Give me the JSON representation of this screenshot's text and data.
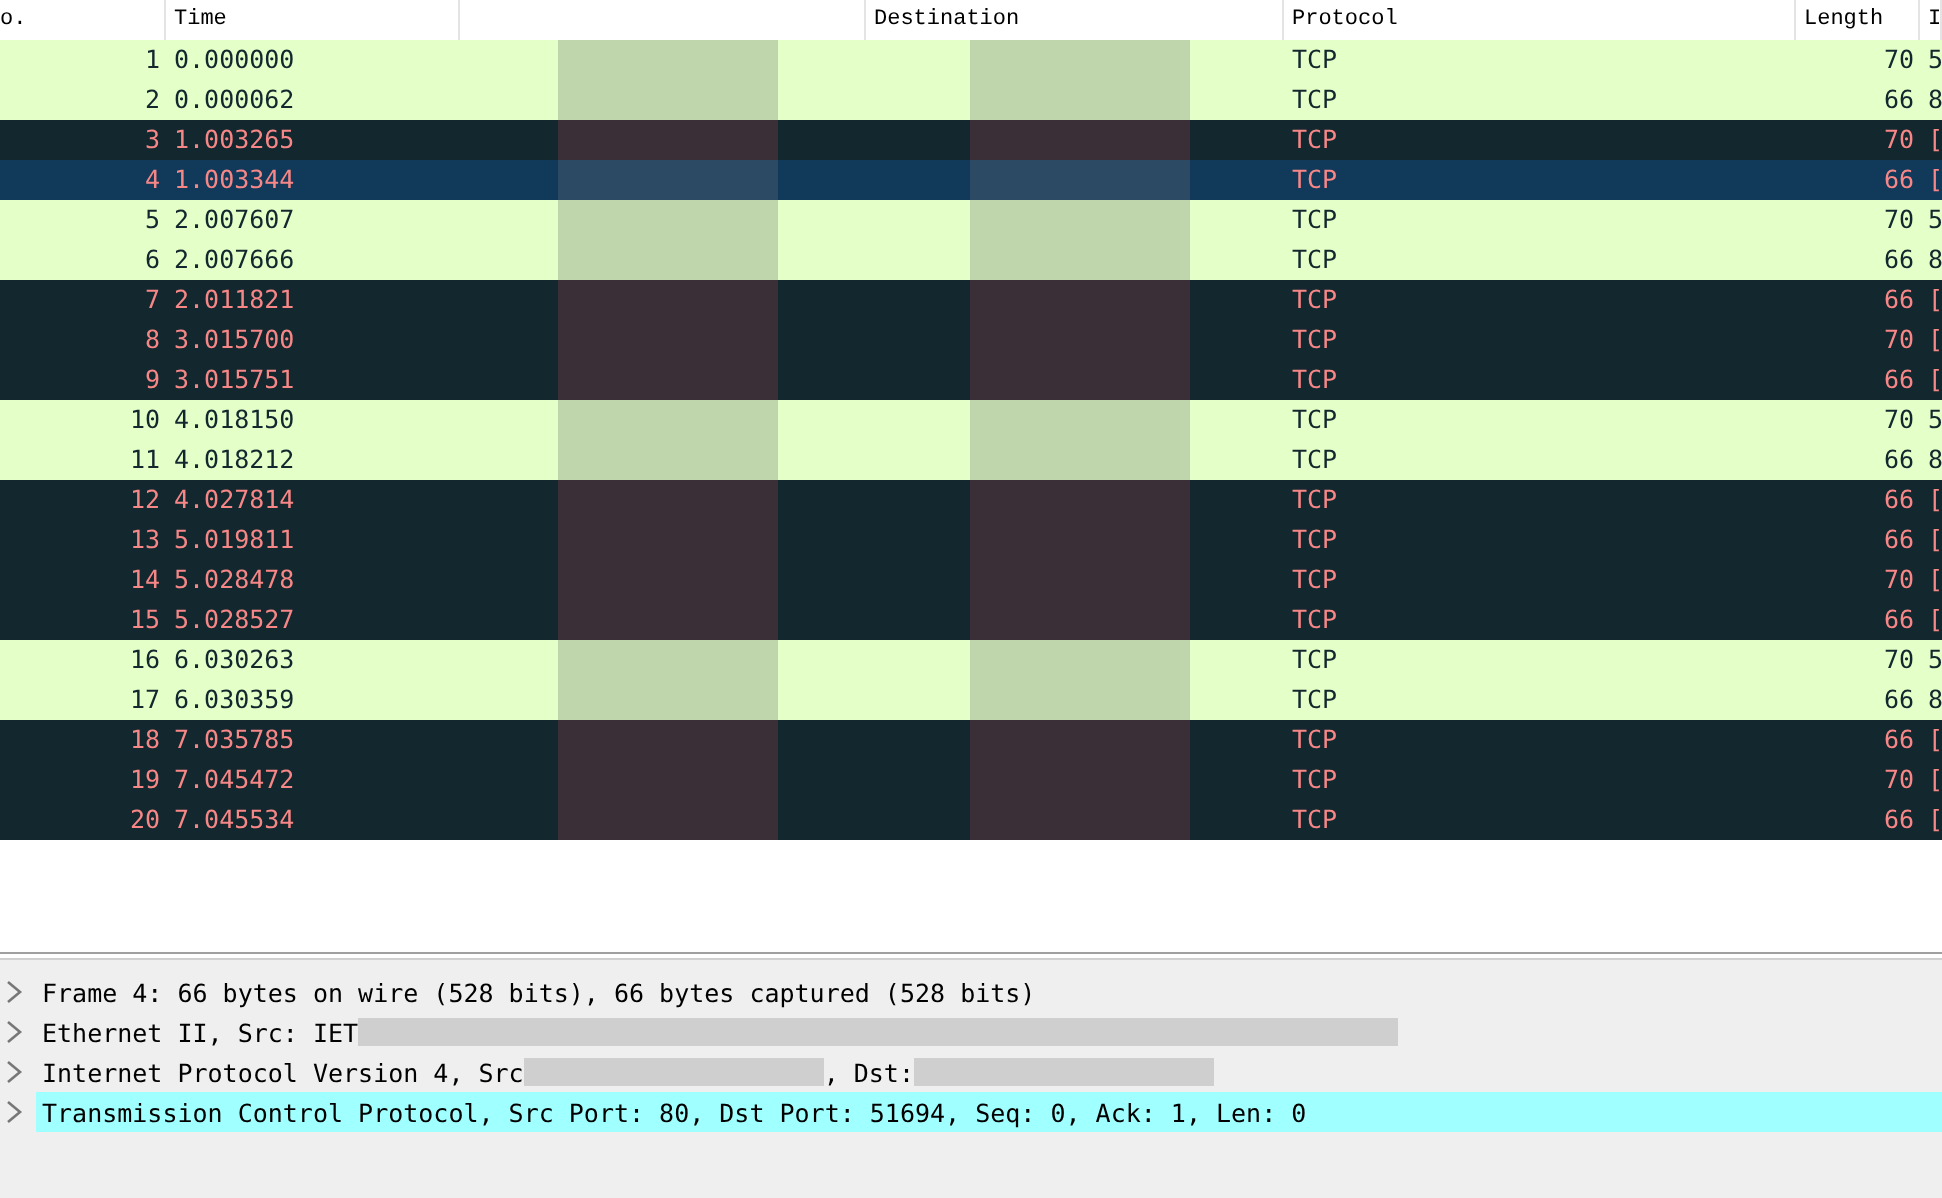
{
  "packet_list": {
    "columns": [
      {
        "label": "o."
      },
      {
        "label": "Time"
      },
      {},
      {
        "label": "Destination"
      },
      {
        "label": "Protocol"
      },
      {
        "label": "Length"
      },
      {
        "label": "I"
      }
    ],
    "rows": [
      {
        "no": "1",
        "time": "0.000000",
        "protocol": "TCP",
        "length": "70",
        "info": "5",
        "kind": "ok",
        "selected": false
      },
      {
        "no": "2",
        "time": "0.000062",
        "protocol": "TCP",
        "length": "66",
        "info": "8",
        "kind": "ok",
        "selected": false
      },
      {
        "no": "3",
        "time": "1.003265",
        "protocol": "TCP",
        "length": "70",
        "info": "[",
        "kind": "bad",
        "selected": false
      },
      {
        "no": "4",
        "time": "1.003344",
        "protocol": "TCP",
        "length": "66",
        "info": "[",
        "kind": "bad",
        "selected": true
      },
      {
        "no": "5",
        "time": "2.007607",
        "protocol": "TCP",
        "length": "70",
        "info": "5",
        "kind": "ok",
        "selected": false
      },
      {
        "no": "6",
        "time": "2.007666",
        "protocol": "TCP",
        "length": "66",
        "info": "8",
        "kind": "ok",
        "selected": false
      },
      {
        "no": "7",
        "time": "2.011821",
        "protocol": "TCP",
        "length": "66",
        "info": "[",
        "kind": "bad",
        "selected": false
      },
      {
        "no": "8",
        "time": "3.015700",
        "protocol": "TCP",
        "length": "70",
        "info": "[",
        "kind": "bad",
        "selected": false
      },
      {
        "no": "9",
        "time": "3.015751",
        "protocol": "TCP",
        "length": "66",
        "info": "[",
        "kind": "bad",
        "selected": false
      },
      {
        "no": "10",
        "time": "4.018150",
        "protocol": "TCP",
        "length": "70",
        "info": "5",
        "kind": "ok",
        "selected": false
      },
      {
        "no": "11",
        "time": "4.018212",
        "protocol": "TCP",
        "length": "66",
        "info": "8",
        "kind": "ok",
        "selected": false
      },
      {
        "no": "12",
        "time": "4.027814",
        "protocol": "TCP",
        "length": "66",
        "info": "[",
        "kind": "bad",
        "selected": false
      },
      {
        "no": "13",
        "time": "5.019811",
        "protocol": "TCP",
        "length": "66",
        "info": "[",
        "kind": "bad",
        "selected": false
      },
      {
        "no": "14",
        "time": "5.028478",
        "protocol": "TCP",
        "length": "70",
        "info": "[",
        "kind": "bad",
        "selected": false
      },
      {
        "no": "15",
        "time": "5.028527",
        "protocol": "TCP",
        "length": "66",
        "info": "[",
        "kind": "bad",
        "selected": false
      },
      {
        "no": "16",
        "time": "6.030263",
        "protocol": "TCP",
        "length": "70",
        "info": "5",
        "kind": "ok",
        "selected": false
      },
      {
        "no": "17",
        "time": "6.030359",
        "protocol": "TCP",
        "length": "66",
        "info": "8",
        "kind": "ok",
        "selected": false
      },
      {
        "no": "18",
        "time": "7.035785",
        "protocol": "TCP",
        "length": "66",
        "info": "[",
        "kind": "bad",
        "selected": false
      },
      {
        "no": "19",
        "time": "7.045472",
        "protocol": "TCP",
        "length": "70",
        "info": "[",
        "kind": "bad",
        "selected": false
      },
      {
        "no": "20",
        "time": "7.045534",
        "protocol": "TCP",
        "length": "66",
        "info": "[",
        "kind": "bad",
        "selected": false
      }
    ]
  },
  "packet_details": [
    {
      "expanded": false,
      "selected": false,
      "parts": [
        {
          "kind": "text",
          "text": "Frame 4: 66 bytes on wire (528 bits), 66 bytes captured (528 bits)"
        }
      ]
    },
    {
      "expanded": false,
      "selected": false,
      "parts": [
        {
          "kind": "text",
          "text": "Ethernet II, Src: IET"
        },
        {
          "kind": "redacted"
        }
      ]
    },
    {
      "expanded": false,
      "selected": false,
      "parts": [
        {
          "kind": "text",
          "text": "Internet Protocol Version 4, Src"
        },
        {
          "kind": "redacted"
        },
        {
          "kind": "text",
          "text": ", Dst:"
        },
        {
          "kind": "redacted"
        }
      ]
    },
    {
      "expanded": false,
      "selected": true,
      "parts": [
        {
          "kind": "text",
          "text": "Transmission Control Protocol, Src Port: 80, Dst Port: 51694, Seq: 0, Ack: 1, Len: 0"
        }
      ]
    }
  ]
}
